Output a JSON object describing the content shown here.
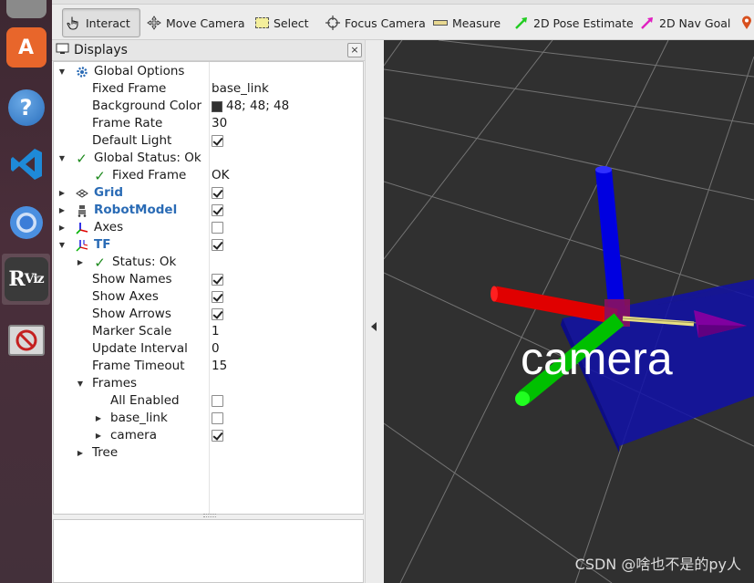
{
  "launcher": {
    "items": [
      {
        "name": "files-icon"
      },
      {
        "name": "software-center-icon"
      },
      {
        "name": "help-icon"
      },
      {
        "name": "vscode-icon"
      },
      {
        "name": "chromium-icon"
      },
      {
        "name": "rviz-icon",
        "label": "RViz"
      },
      {
        "name": "no-entry-icon"
      }
    ]
  },
  "toolbar": {
    "tools": [
      {
        "id": "interact",
        "label": "Interact",
        "active": true
      },
      {
        "id": "move-camera",
        "label": "Move Camera"
      },
      {
        "id": "select",
        "label": "Select"
      },
      {
        "id": "focus-camera",
        "label": "Focus Camera"
      },
      {
        "id": "measure",
        "label": "Measure"
      },
      {
        "id": "pose-estimate",
        "label": "2D Pose Estimate",
        "color": "#22cc22"
      },
      {
        "id": "nav-goal",
        "label": "2D Nav Goal",
        "color": "#e020c0"
      }
    ]
  },
  "displays": {
    "title": "Displays",
    "close": "×",
    "rows": [
      {
        "label": "Global Options",
        "arrow": "open"
      },
      {
        "label": "Fixed Frame",
        "value": "base_link"
      },
      {
        "label": "Background Color",
        "value": "48; 48; 48",
        "swatch": "#303030"
      },
      {
        "label": "Frame Rate",
        "value": "30"
      },
      {
        "label": "Default Light",
        "checked": true
      },
      {
        "label": "Global Status: Ok",
        "arrow": "open"
      },
      {
        "label": "Fixed Frame",
        "value": "OK"
      },
      {
        "label": "Grid",
        "checked": true
      },
      {
        "label": "RobotModel",
        "checked": true
      },
      {
        "label": "Axes",
        "checked": false
      },
      {
        "label": "TF",
        "checked": true
      },
      {
        "label": "Status: Ok"
      },
      {
        "label": "Show Names",
        "checked": true
      },
      {
        "label": "Show Axes",
        "checked": true
      },
      {
        "label": "Show Arrows",
        "checked": true
      },
      {
        "label": "Marker Scale",
        "value": "1"
      },
      {
        "label": "Update Interval",
        "value": "0"
      },
      {
        "label": "Frame Timeout",
        "value": "15"
      },
      {
        "label": "Frames"
      },
      {
        "label": "All Enabled",
        "checked": false
      },
      {
        "label": "base_link",
        "checked": false
      },
      {
        "label": "camera",
        "checked": true
      },
      {
        "label": "Tree"
      }
    ]
  },
  "viewport": {
    "background": "#303030",
    "frame_label": "camera",
    "axis_colors": {
      "x": "#e00000",
      "y": "#00c000",
      "z": "#0000e0"
    },
    "watermark": "CSDN @啥也不是的py人"
  }
}
